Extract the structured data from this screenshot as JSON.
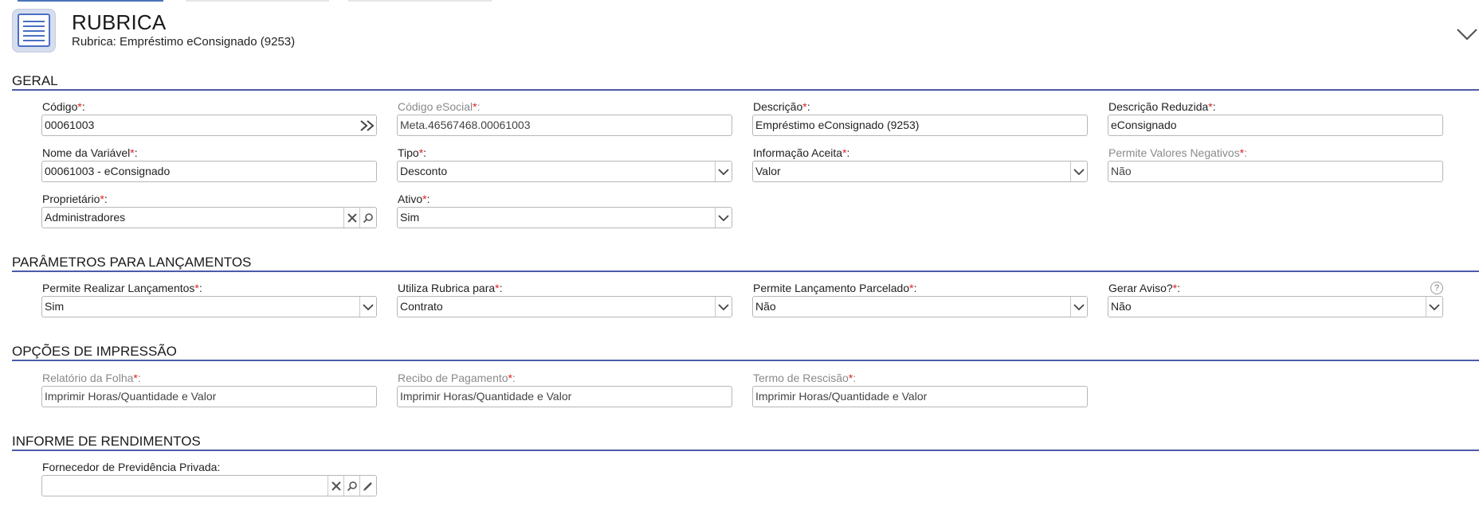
{
  "header": {
    "title": "RUBRICA",
    "subtitle": "Rubrica: Empréstimo eConsignado (9253)"
  },
  "sections": {
    "geral": "GERAL",
    "parametros": "PARÂMETROS PARA LANÇAMENTOS",
    "impressao": "OPÇÕES DE IMPRESSÃO",
    "informe": "INFORME DE RENDIMENTOS"
  },
  "required_mark": "*",
  "label_suffix": ":",
  "geral": {
    "codigo": {
      "label": "Código",
      "value": "00061003"
    },
    "codigo_esocial": {
      "label": "Código eSocial",
      "value": "Meta.46567468.00061003"
    },
    "descricao": {
      "label": "Descrição",
      "value": "Empréstimo eConsignado (9253)"
    },
    "descricao_reduzida": {
      "label": "Descrição Reduzida",
      "value": "eConsignado"
    },
    "nome_variavel": {
      "label": "Nome da Variável",
      "value": "00061003 - eConsignado"
    },
    "tipo": {
      "label": "Tipo",
      "value": "Desconto"
    },
    "informacao_aceita": {
      "label": "Informação Aceita",
      "value": "Valor"
    },
    "permite_negativos": {
      "label": "Permite Valores Negativos",
      "value": "Não"
    },
    "proprietario": {
      "label": "Proprietário",
      "value": "Administradores"
    },
    "ativo": {
      "label": "Ativo",
      "value": "Sim"
    }
  },
  "parametros": {
    "permite_lancamentos": {
      "label": "Permite Realizar Lançamentos",
      "value": "Sim"
    },
    "utiliza_rubrica": {
      "label": "Utiliza Rubrica para",
      "value": "Contrato"
    },
    "permite_parcelado": {
      "label": "Permite Lançamento Parcelado",
      "value": "Não"
    },
    "gerar_aviso": {
      "label": "Gerar Aviso?",
      "value": "Não"
    },
    "help_glyph": "?"
  },
  "impressao": {
    "relatorio_folha": {
      "label": "Relatório da Folha",
      "value": "Imprimir Horas/Quantidade e Valor"
    },
    "recibo_pagamento": {
      "label": "Recibo de Pagamento",
      "value": "Imprimir Horas/Quantidade e Valor"
    },
    "termo_rescisao": {
      "label": "Termo de Rescisão",
      "value": "Imprimir Horas/Quantidade e Valor"
    }
  },
  "informe": {
    "fornecedor": {
      "label": "Fornecedor de Previdência Privada",
      "value": ""
    }
  },
  "colors": {
    "accent": "#4d5aa8",
    "required": "#e02020",
    "disabled_label": "#8a8a8a"
  }
}
